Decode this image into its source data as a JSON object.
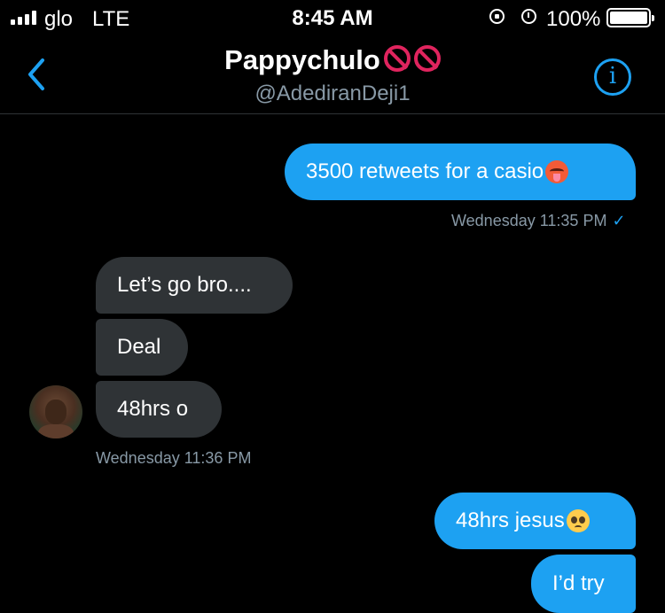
{
  "status_bar": {
    "carrier": "glo",
    "network": "LTE",
    "time": "8:45 AM",
    "battery": "100%",
    "icons": [
      "signal-icon",
      "rotation-lock-icon",
      "alarm-icon",
      "battery-icon"
    ]
  },
  "header": {
    "name": "Pappychulo",
    "name_emoji": [
      "no-entry-sign-emoji",
      "no-entry-sign-emoji"
    ],
    "handle": "@AdediranDeji1",
    "back_icon": "chevron-left-icon",
    "info_icon": "info-icon",
    "info_glyph": "i"
  },
  "colors": {
    "background": "#000000",
    "accent": "#1da1f2",
    "received_bubble": "#2f3336",
    "secondary_text": "#8899a6",
    "no_entry": "#e0245e"
  },
  "messages": [
    {
      "side": "sent",
      "text": "3500 retweets for a casio",
      "emoji": "hot-face-emoji"
    },
    {
      "side": "sent_timestamp",
      "text": "Wednesday 11:35 PM",
      "status": "✓"
    },
    {
      "side": "received",
      "text": "Let’s go bro...."
    },
    {
      "side": "received",
      "text": "Deal"
    },
    {
      "side": "received",
      "text": "48hrs o"
    },
    {
      "side": "received_timestamp",
      "text": "Wednesday 11:36 PM"
    },
    {
      "side": "sent",
      "text": "48hrs jesus",
      "emoji": "pleading-face-emoji"
    },
    {
      "side": "sent",
      "text": "I’d try"
    }
  ]
}
